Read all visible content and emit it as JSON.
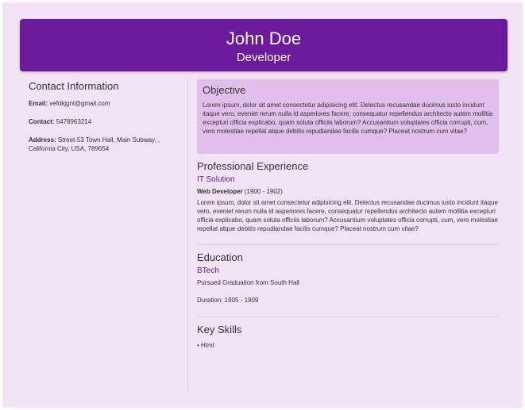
{
  "header": {
    "name": "John Doe",
    "role": "Developer"
  },
  "contact": {
    "title": "Contact Information",
    "email_label": "Email:",
    "email": "vefdkjgnl@gmail.com",
    "contact_label": "Contact:",
    "phone": "5478963214",
    "address_label": "Address:",
    "address": "Street-53 Town Hall, Main Subway, , California City, USA, 789654"
  },
  "objective": {
    "title": "Objective",
    "text": "Lorem ipsum, dolor sit amet consectetur adipisicing elit. Delectus recusandae ducimus iusto incidunt itaque vero, eveniet rerum nulla id asperiores facere, consequatur repellendus architecto autem mollitia excepturi officia explicabo, quam soluta officiis laborum? Accusantium voluptates officia corrupti, cum, vero molestiae repellat atque debitis repudiandae facilis cumque? Placeat nostrum cum vitae?"
  },
  "experience": {
    "title": "Professional Experience",
    "company": "IT Solution",
    "position": "Web Developer",
    "period": "(1900 - 1902)",
    "text": "Lorem ipsum, dolor sit amet consectetur adipisicing elit. Delectus recusandae ducimus iusto incidunt itaque vero, eveniet rerum nulla id asperiores facere, consequatur repellendus architecto autem mollitia excepturi officia explicabo, quam soluta officiis laborum? Accusantium voluptates officia corrupti, cum, vero molestiae repellat atque debitis repudiandae facilis cumque? Placeat nostrum cum vitae?"
  },
  "education": {
    "title": "Education",
    "degree": "BTech",
    "description": "Pursued Graduation from South Hall",
    "duration": "Duration: 1905 - 1909"
  },
  "skills": {
    "title": "Key Skills",
    "items": [
      "Html"
    ]
  }
}
